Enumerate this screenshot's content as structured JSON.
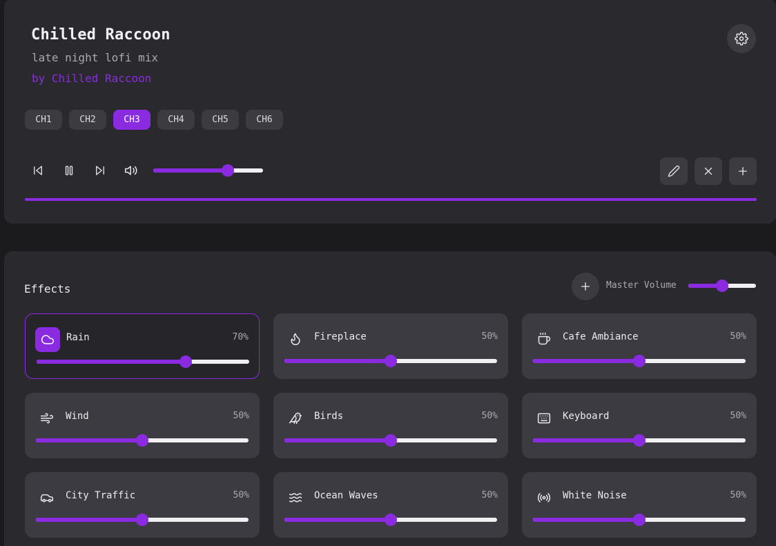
{
  "player": {
    "title": "Chilled Raccoon",
    "subtitle": "late night lofi mix",
    "artist": "by Chilled Raccoon",
    "channels": [
      "CH1",
      "CH2",
      "CH3",
      "CH4",
      "CH5",
      "CH6"
    ],
    "active_channel": "CH3",
    "volume": 0.68,
    "progress": 1.0
  },
  "effects": {
    "title": "Effects",
    "master_label": "Master Volume",
    "master_volume": 0.5,
    "items": [
      {
        "name": "Rain",
        "pct": "70%",
        "level": 0.7,
        "icon": "cloud-icon",
        "active": true
      },
      {
        "name": "Fireplace",
        "pct": "50%",
        "level": 0.5,
        "icon": "flame-icon",
        "active": false
      },
      {
        "name": "Cafe Ambiance",
        "pct": "50%",
        "level": 0.5,
        "icon": "coffee-icon",
        "active": false
      },
      {
        "name": "Wind",
        "pct": "50%",
        "level": 0.5,
        "icon": "wind-icon",
        "active": false
      },
      {
        "name": "Birds",
        "pct": "50%",
        "level": 0.5,
        "icon": "bird-icon",
        "active": false
      },
      {
        "name": "Keyboard",
        "pct": "50%",
        "level": 0.5,
        "icon": "keyboard-icon",
        "active": false
      },
      {
        "name": "City Traffic",
        "pct": "50%",
        "level": 0.5,
        "icon": "car-icon",
        "active": false
      },
      {
        "name": "Ocean Waves",
        "pct": "50%",
        "level": 0.5,
        "icon": "waves-icon",
        "active": false
      },
      {
        "name": "White Noise",
        "pct": "50%",
        "level": 0.5,
        "icon": "radio-icon",
        "active": false
      }
    ]
  },
  "colors": {
    "accent": "#8a2be2",
    "panel": "#2a2a2e",
    "card": "#3c3b41",
    "background": "#1b1b1e"
  }
}
